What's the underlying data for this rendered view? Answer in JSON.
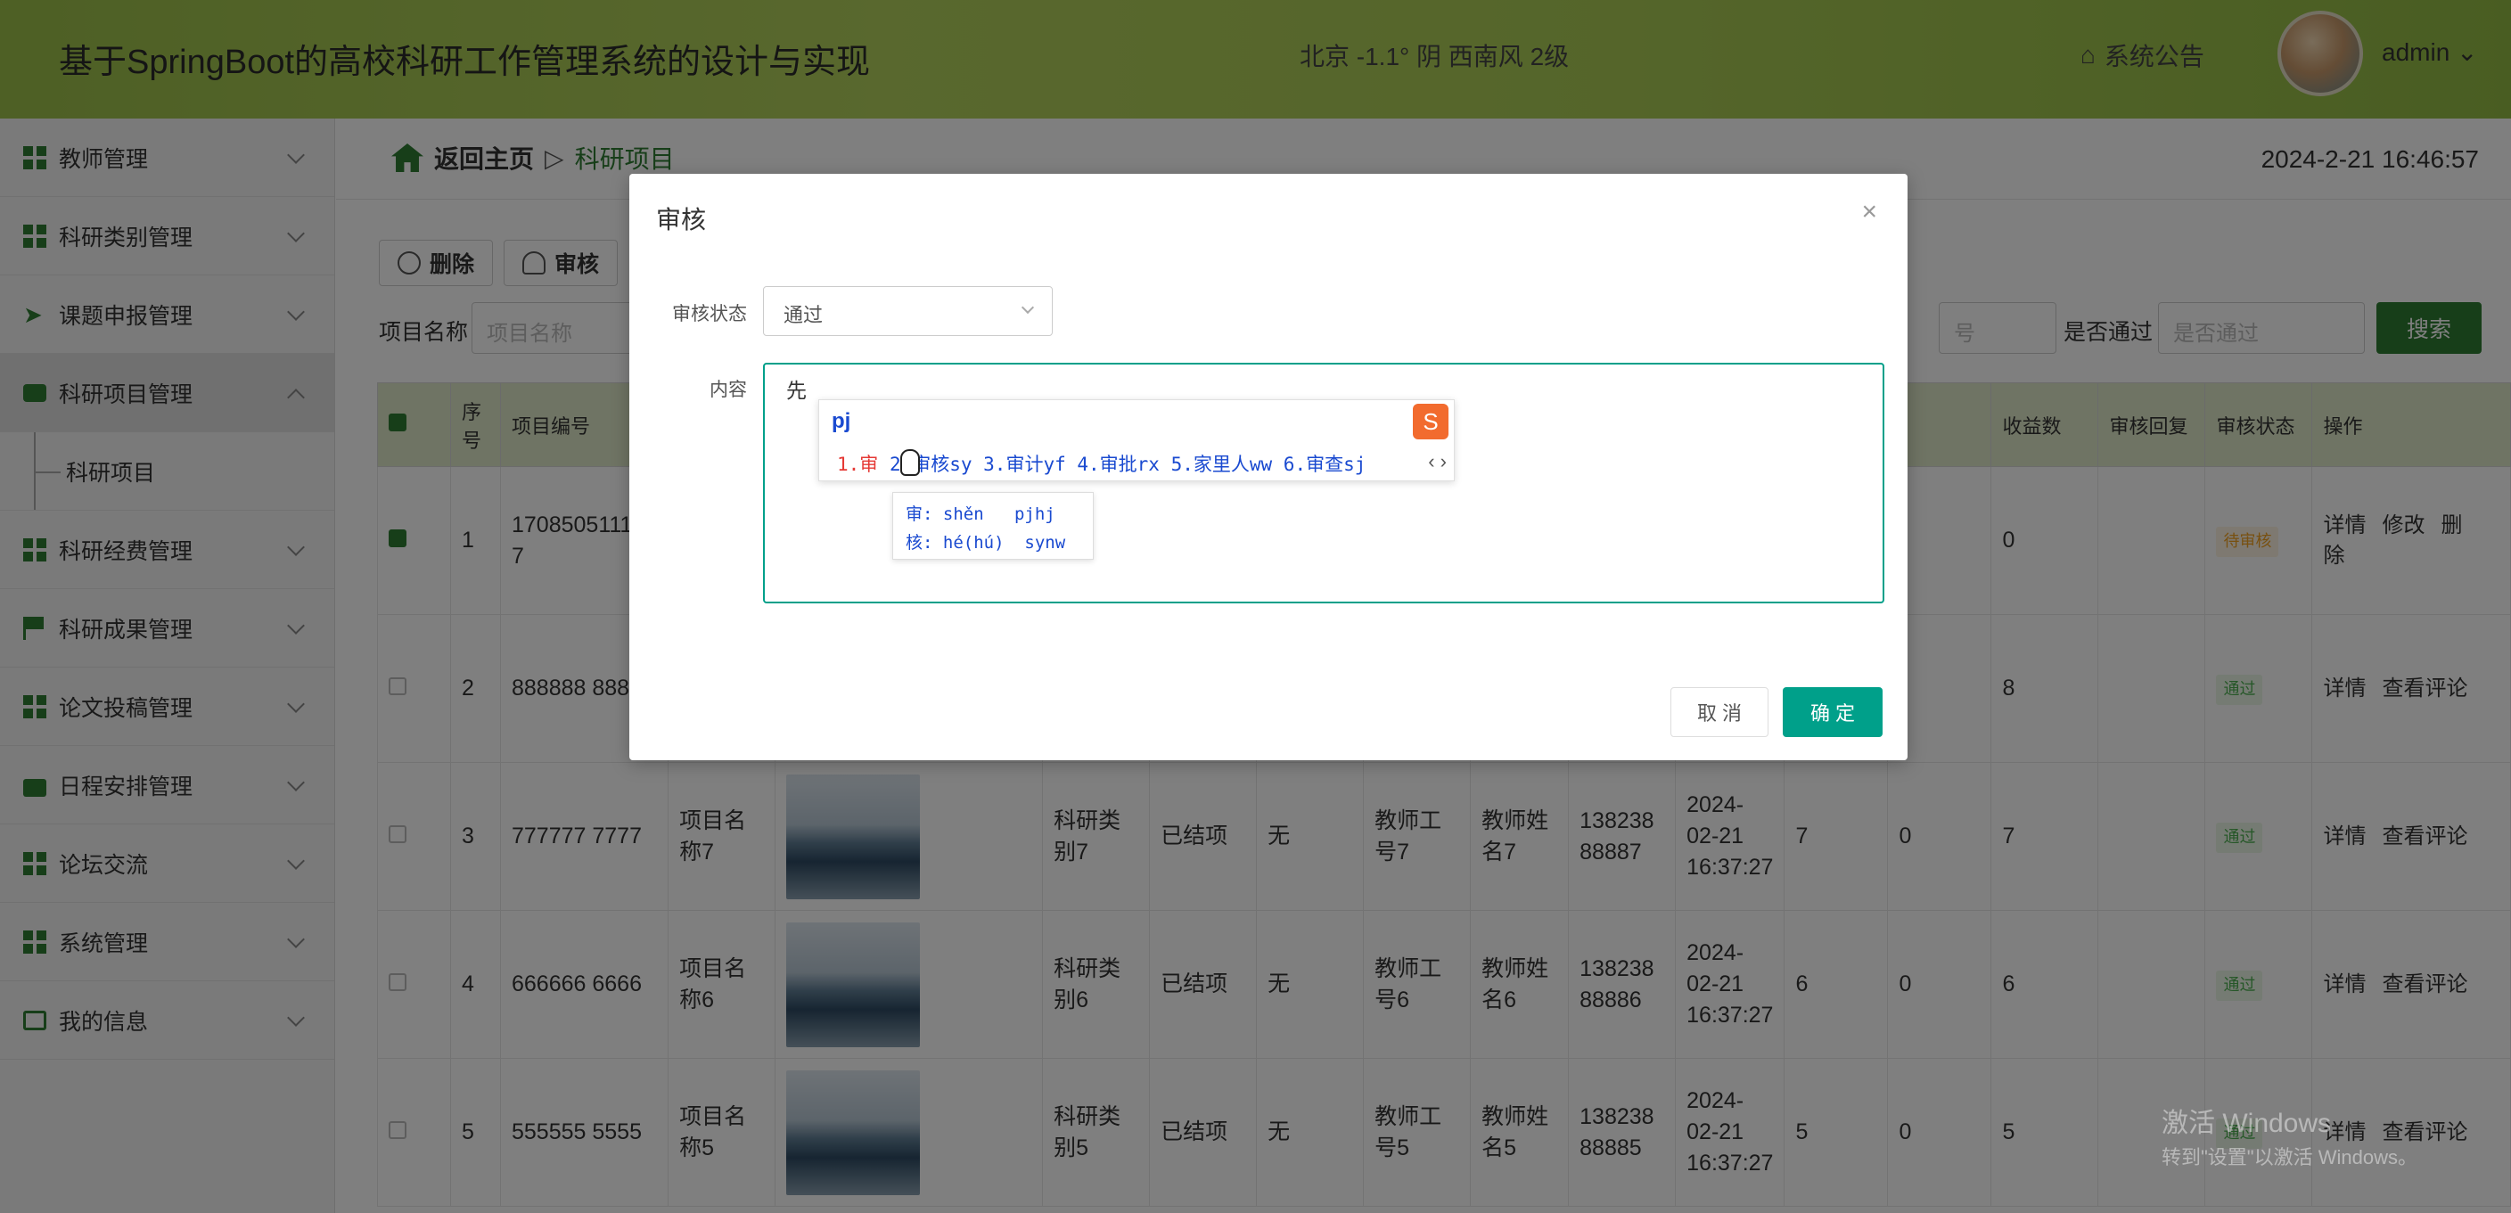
{
  "header": {
    "title": "基于SpringBoot的高校科研工作管理系统的设计与实现",
    "weather": "北京  -1.1°  阴  西南风  2级",
    "notice": "系统公告",
    "user": "admin"
  },
  "sidebar": {
    "items": [
      {
        "label": "教师管理"
      },
      {
        "label": "科研类别管理"
      },
      {
        "label": "课题申报管理"
      },
      {
        "label": "科研项目管理"
      },
      {
        "label": "科研项目"
      },
      {
        "label": "科研经费管理"
      },
      {
        "label": "科研成果管理"
      },
      {
        "label": "论文投稿管理"
      },
      {
        "label": "日程安排管理"
      },
      {
        "label": "论坛交流"
      },
      {
        "label": "系统管理"
      },
      {
        "label": "我的信息"
      }
    ]
  },
  "breadcrumb": {
    "home": "返回主页",
    "sep": "▷",
    "current": "科研项目"
  },
  "clock": "2024-2-21 16:46:57",
  "toolbar": {
    "delete": "删除",
    "audit": "审核"
  },
  "filters": {
    "name_label": "项目名称",
    "name_placeholder": "项目名称",
    "other_placeholder": "号",
    "pass_label": "是否通过",
    "pass_placeholder": "是否通过",
    "search": "搜索"
  },
  "table": {
    "headers": [
      "序号",
      "项目编号",
      "收益数",
      "审核回复",
      "审核状态",
      "操作"
    ],
    "rows": [
      {
        "idx": "1",
        "code": "170850511149 7",
        "name": "",
        "type": "",
        "stage": "",
        "none": "",
        "tid": "",
        "tname": "",
        "phone": "",
        "time": "",
        "n1": "",
        "n2": "",
        "n3": "0",
        "status": "待审核",
        "op": [
          "详情",
          "修改",
          "删除"
        ]
      },
      {
        "idx": "2",
        "code": "888888 8888",
        "name": "",
        "type": "",
        "stage": "",
        "none": "",
        "tid": "",
        "tname": "",
        "phone": "",
        "time": "",
        "n1": "",
        "n2": "",
        "n3": "8",
        "status": "通过",
        "op": [
          "详情",
          "查看评论"
        ]
      },
      {
        "idx": "3",
        "code": "777777 7777",
        "name": "项目名称7",
        "type": "科研类别7",
        "stage": "已结项",
        "none": "无",
        "tid": "教师工号7",
        "tname": "教师姓名7",
        "phone": "138238 88887",
        "time": "2024-02-21 16:37:27",
        "n1": "7",
        "n2": "0",
        "n3": "7",
        "status": "通过",
        "op": [
          "详情",
          "查看评论"
        ]
      },
      {
        "idx": "4",
        "code": "666666 6666",
        "name": "项目名称6",
        "type": "科研类别6",
        "stage": "已结项",
        "none": "无",
        "tid": "教师工号6",
        "tname": "教师姓名6",
        "phone": "138238 88886",
        "time": "2024-02-21 16:37:27",
        "n1": "6",
        "n2": "0",
        "n3": "6",
        "status": "通过",
        "op": [
          "详情",
          "查看评论"
        ]
      },
      {
        "idx": "5",
        "code": "555555 5555",
        "name": "项目名称5",
        "type": "科研类别5",
        "stage": "已结项",
        "none": "无",
        "tid": "教师工号5",
        "tname": "教师姓名5",
        "phone": "138238 88885",
        "time": "2024-02-21 16:37:27",
        "n1": "5",
        "n2": "0",
        "n3": "5",
        "status": "通过",
        "op": [
          "详情",
          "查看评论"
        ]
      }
    ]
  },
  "dialog": {
    "title": "审核",
    "status_label": "审核状态",
    "status_value": "通过",
    "content_label": "内容",
    "content_value": "先",
    "cancel": "取 消",
    "confirm": "确 定"
  },
  "ime": {
    "composition": "pj",
    "candidates_first": "1.审",
    "candidates_rest": " 2.审核sy  3.审计yf  4.审批rx  5.家里人ww  6.审查sj",
    "nav": "‹ ›",
    "hint_line1": "审: shěn   pjhj",
    "hint_line2": "核: hé(hú)  synw"
  },
  "watermark": {
    "line1": "激活 Windows",
    "line2": "转到\"设置\"以激活 Windows。"
  },
  "colors": {
    "accent": "#00a08a",
    "brand": "#2e7d32",
    "header": "#a8c955"
  }
}
